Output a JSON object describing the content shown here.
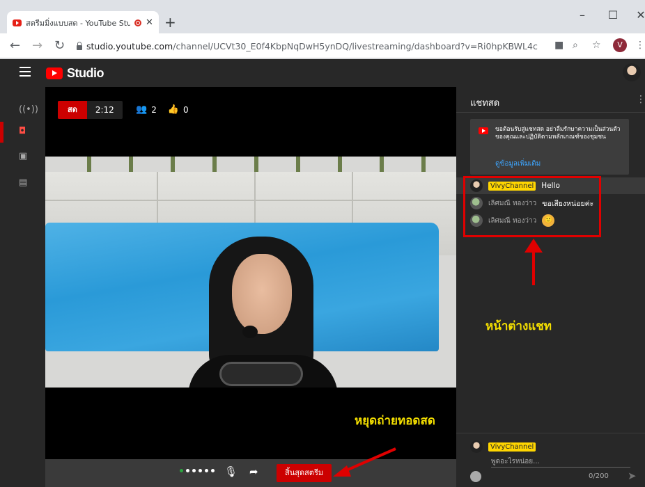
{
  "browser": {
    "tab_title": "สตรีมมิ่งแบบสด - YouTube Stuc",
    "tab_close": "✕",
    "new_tab": "+",
    "window_minimize": "–",
    "window_maximize": "☐",
    "window_close": "✕",
    "url_host": "studio.youtube.com",
    "url_path": "/channel/UCVt30_E0f4KbpNqDwH5ynDQ/livestreaming/dashboard?v=Ri0hpKBWL4c",
    "profile_initial": "V"
  },
  "studio": {
    "logo_text": "Studio",
    "live_badge": "สด",
    "elapsed": "2:12",
    "viewers": "2",
    "likes": "0",
    "end_stream_button": "สิ้นสุดสตรีม"
  },
  "chat": {
    "title": "แชทสด",
    "notice": "ขอต้อนรับสู่แชทสด อย่าลืมรักษาความเป็นส่วนตัวของคุณและปฏิบัติตามหลักเกณฑ์ของชุมชน",
    "notice_link": "ดูข้อมูลเพิ่มเติม",
    "messages": [
      {
        "author": "VivyChannel",
        "text": "Hello",
        "is_owner": true
      },
      {
        "author": "เลิศมณี ทองว่าว",
        "text": "ขอเสียงหน่อยค่ะ",
        "is_owner": false
      },
      {
        "author": "เลิศมณี ทองว่าว",
        "text": "",
        "is_owner": false,
        "emoji": "🙂"
      }
    ],
    "input_author": "VivyChannel",
    "input_text": "พูดอะไรหน่อย...",
    "char_count": "0/200"
  },
  "annotations": {
    "stop_live": "หยุดถ่ายทอดสด",
    "chat_window": "หน้าต่างแชท",
    "color": "#f5e000",
    "box_color": "#e00000"
  }
}
